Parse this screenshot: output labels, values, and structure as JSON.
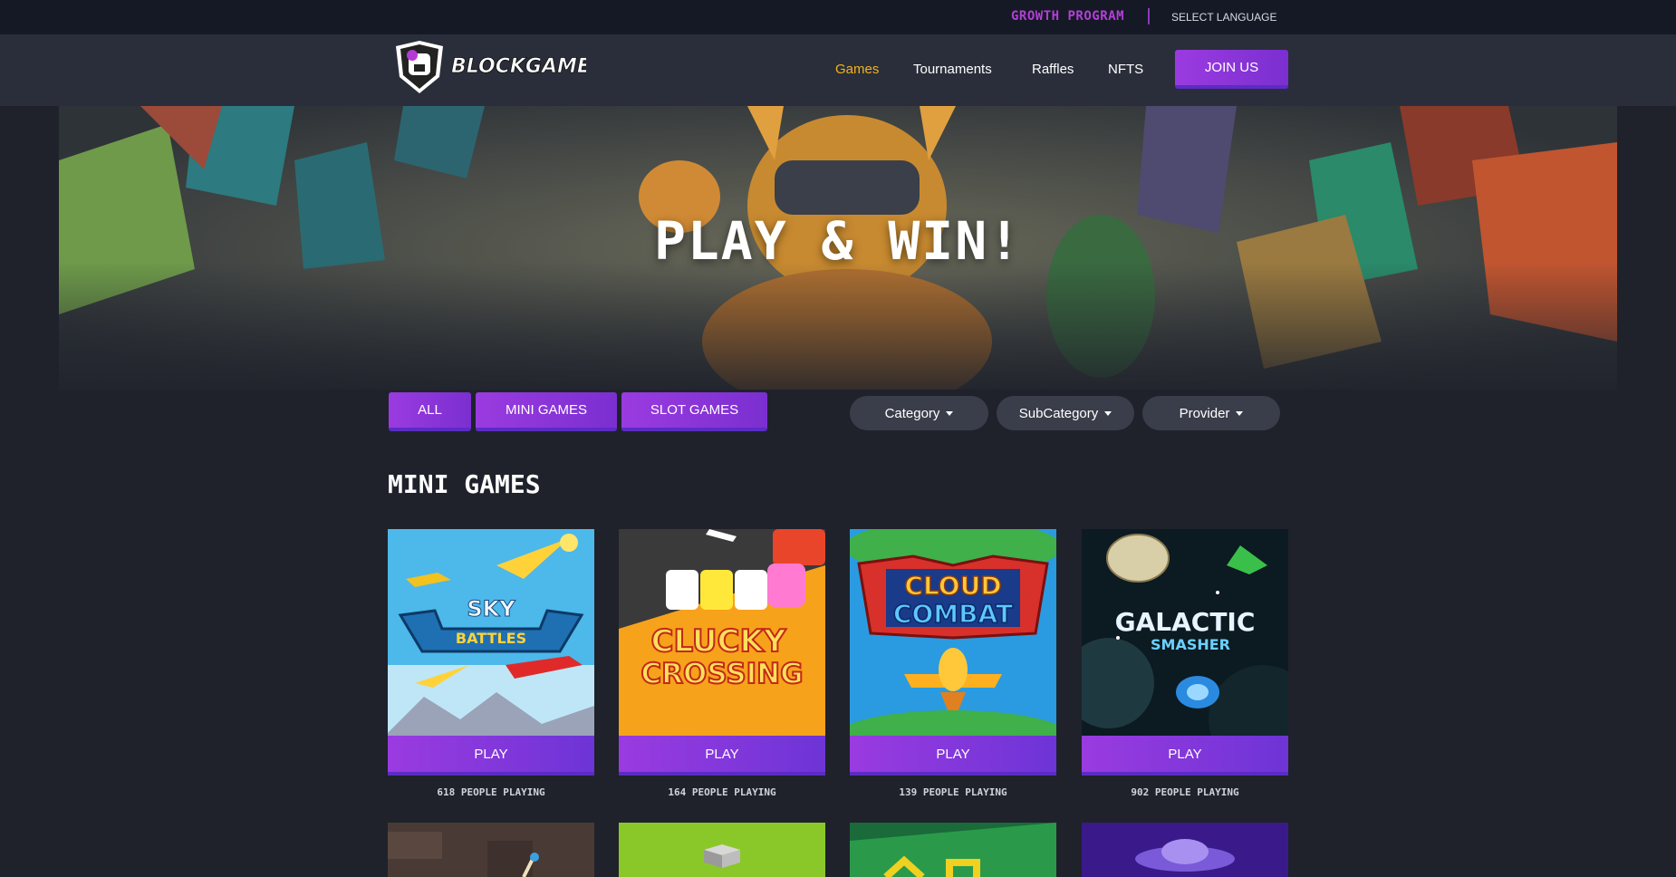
{
  "topbar": {
    "growth_label": "GROWTH PROGRAM",
    "language_label": "SELECT LANGUAGE"
  },
  "brand": {
    "logo_text": "BLOCKGAMER"
  },
  "nav": {
    "items": [
      "Games",
      "Tournaments",
      "Raffles",
      "NFTS"
    ],
    "active": "Games",
    "join_label": "JOIN US"
  },
  "hero": {
    "title": "PLAY & WIN!"
  },
  "filters": {
    "tabs": [
      "ALL",
      "MINI GAMES",
      "SLOT GAMES"
    ],
    "dropdowns": [
      "Category",
      "SubCategory",
      "Provider"
    ]
  },
  "section": {
    "title": "MINI GAMES"
  },
  "games": [
    {
      "title_lines": [
        "SKY",
        "BATTLES"
      ],
      "play_label": "PLAY",
      "playing": "618 PEOPLE PLAYING"
    },
    {
      "title_lines": [
        "CLUCKY",
        "CROSSING"
      ],
      "play_label": "PLAY",
      "playing": "164 PEOPLE PLAYING"
    },
    {
      "title_lines": [
        "CLOUD",
        "COMBAT"
      ],
      "play_label": "PLAY",
      "playing": "139 PEOPLE PLAYING"
    },
    {
      "title_lines": [
        "GALACTIC",
        "SMASHER"
      ],
      "play_label": "PLAY",
      "playing": "902 PEOPLE PLAYING"
    }
  ],
  "colors": {
    "accent": "#9a3be0",
    "active_nav": "#f3b31b",
    "page_bg": "#1f222b",
    "nav_bg": "#2a2e3a"
  }
}
